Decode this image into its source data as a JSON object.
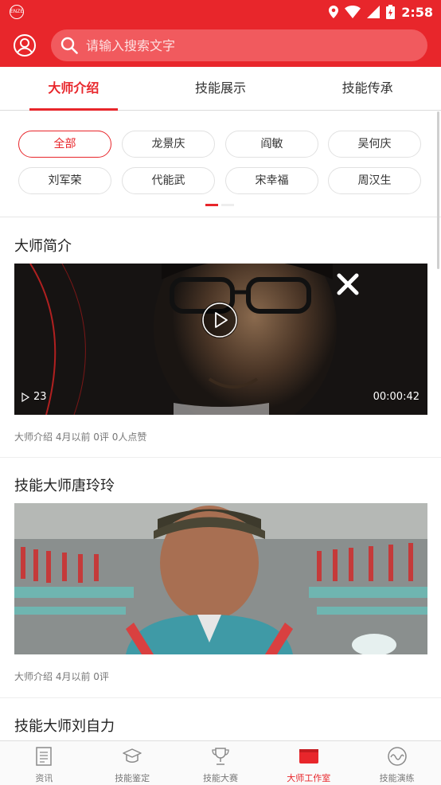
{
  "status_bar": {
    "time": "2:58",
    "app_logo_text": "ENZE"
  },
  "search": {
    "placeholder": "请输入搜索文字"
  },
  "tabs": [
    {
      "label": "大师介绍",
      "active": true
    },
    {
      "label": "技能展示",
      "active": false
    },
    {
      "label": "技能传承",
      "active": false
    }
  ],
  "masters": [
    {
      "label": "全部",
      "active": true
    },
    {
      "label": "龙景庆",
      "active": false
    },
    {
      "label": "阎敏",
      "active": false
    },
    {
      "label": "吴何庆",
      "active": false
    },
    {
      "label": "刘军荣",
      "active": false
    },
    {
      "label": "代能武",
      "active": false
    },
    {
      "label": "宋幸福",
      "active": false
    },
    {
      "label": "周汉生",
      "active": false
    }
  ],
  "feed": [
    {
      "title": "大师简介",
      "play_count": "23",
      "duration": "00:00:42",
      "meta": "大师介绍  4月以前  0评 0人点赞"
    },
    {
      "title": "技能大师唐玲玲",
      "meta": "大师介绍  4月以前  0评"
    },
    {
      "title": "技能大师刘自力"
    }
  ],
  "bottom_nav": [
    {
      "label": "资讯",
      "icon": "news-icon",
      "active": false
    },
    {
      "label": "技能鉴定",
      "icon": "graduation-cap-icon",
      "active": false
    },
    {
      "label": "技能大赛",
      "icon": "trophy-icon",
      "active": false
    },
    {
      "label": "大师工作室",
      "icon": "studio-icon",
      "active": true
    },
    {
      "label": "技能演练",
      "icon": "practice-icon",
      "active": false
    }
  ],
  "colors": {
    "accent": "#e8262b",
    "search_bg": "#f15a5e"
  }
}
